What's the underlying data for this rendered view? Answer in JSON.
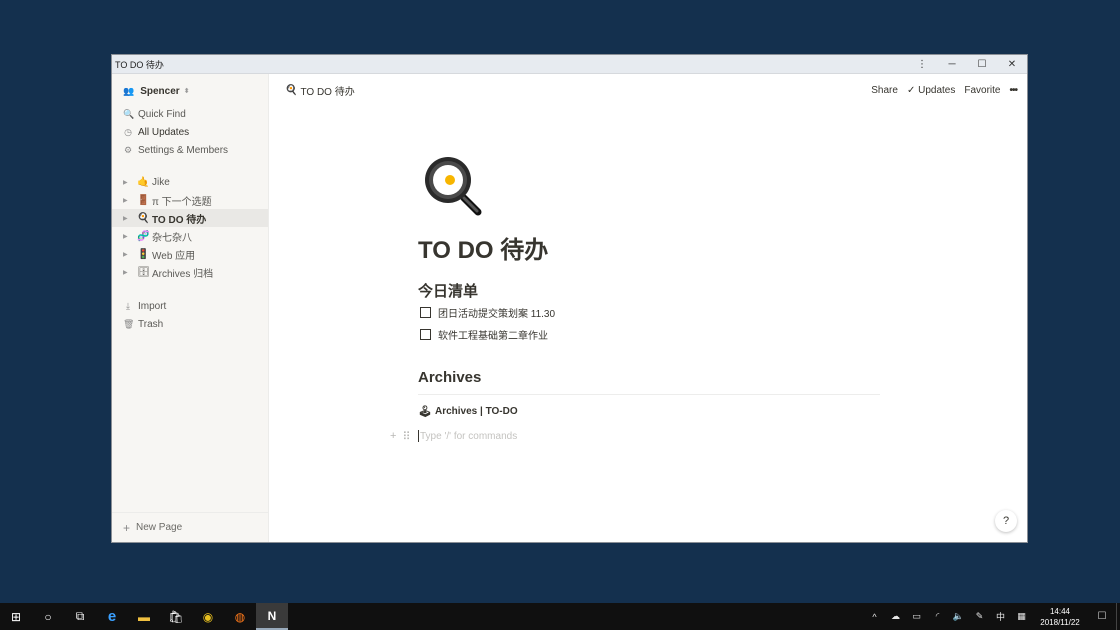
{
  "window": {
    "title": "TO DO 待办",
    "menu_icon": "⋮",
    "minimize_icon": "─",
    "maximize_icon": "☐",
    "close_icon": "✕"
  },
  "sidebar": {
    "workspace": {
      "icon": "👥",
      "name": "Spencer",
      "chevron": "⬍"
    },
    "nav": [
      {
        "icon": "🔍",
        "icon_name": "search-icon",
        "label": "Quick Find"
      },
      {
        "icon": "◷",
        "icon_name": "clock-icon",
        "label": "All Updates"
      },
      {
        "icon": "⚙",
        "icon_name": "gear-icon",
        "label": "Settings & Members"
      }
    ],
    "pages": [
      {
        "emoji": "🤙",
        "icon_name": "jike-emoji-icon",
        "label": "Jike",
        "active": false
      },
      {
        "emoji": "🚪",
        "icon_name": "door-emoji-icon",
        "label": "π 下一个选题",
        "active": false
      },
      {
        "emoji": "🍳",
        "icon_name": "frying-pan-emoji-icon",
        "label": "TO DO 待办",
        "active": true
      },
      {
        "emoji": "🧬",
        "icon_name": "dna-emoji-icon",
        "label": "杂七杂八",
        "active": false
      },
      {
        "emoji": "🚦",
        "icon_name": "web-emoji-icon",
        "label": "Web 应用",
        "active": false
      },
      {
        "emoji": "🗄",
        "icon_name": "cabinet-emoji-icon",
        "label": "Archives 归档",
        "active": false
      }
    ],
    "bottom": [
      {
        "icon": "⤓",
        "icon_name": "import-icon",
        "label": "Import"
      },
      {
        "icon": "🗑",
        "icon_name": "trash-icon",
        "label": "Trash"
      }
    ],
    "new_page": {
      "icon": "+",
      "label": "New Page"
    }
  },
  "topbar": {
    "breadcrumb_icon": "🍳",
    "breadcrumb": "TO DO 待办",
    "share": "Share",
    "updates_check": "✓",
    "updates": "Updates",
    "favorite": "Favorite",
    "more": "•••"
  },
  "page": {
    "title": "TO DO 待办",
    "section1": "今日清单",
    "todos": [
      {
        "text": "团日活动提交策划案 11.30",
        "checked": false
      },
      {
        "text": "软件工程基础第二章作业",
        "checked": false
      }
    ],
    "section2": "Archives",
    "subpage_icon": "🕹",
    "subpage": "Archives | TO-DO",
    "placeholder": "Type '/' for commands",
    "add_icon": "+",
    "drag_icon": "⠿"
  },
  "help": "?",
  "taskbar": {
    "apps": [
      {
        "glyph": "⊞",
        "name": "start-button"
      },
      {
        "glyph": "○",
        "name": "cortana-button"
      },
      {
        "glyph": "⧉",
        "name": "task-view-button"
      },
      {
        "glyph": "e",
        "name": "edge-app"
      },
      {
        "glyph": "▬",
        "name": "file-explorer-app"
      },
      {
        "glyph": "🛍",
        "name": "store-app"
      },
      {
        "glyph": "◉",
        "name": "chrome-app"
      },
      {
        "glyph": "◍",
        "name": "firefox-app"
      },
      {
        "glyph": "N",
        "name": "notion-app"
      }
    ],
    "tray": [
      {
        "glyph": "^",
        "name": "tray-expand-icon"
      },
      {
        "glyph": "☁",
        "name": "onedrive-icon"
      },
      {
        "glyph": "▭",
        "name": "battery-icon"
      },
      {
        "glyph": "◜",
        "name": "wifi-icon"
      },
      {
        "glyph": "🔈",
        "name": "volume-icon"
      },
      {
        "glyph": "✎",
        "name": "pen-icon"
      },
      {
        "glyph": "中",
        "name": "ime-icon"
      },
      {
        "glyph": "▦",
        "name": "keyboard-icon"
      }
    ],
    "time": "14:44",
    "date": "2018/11/22",
    "notification": "☐"
  },
  "colors": {
    "desktop": "#14304e",
    "sidebar": "#f7f6f3",
    "text": "#37352f",
    "taskbar": "#101010"
  }
}
